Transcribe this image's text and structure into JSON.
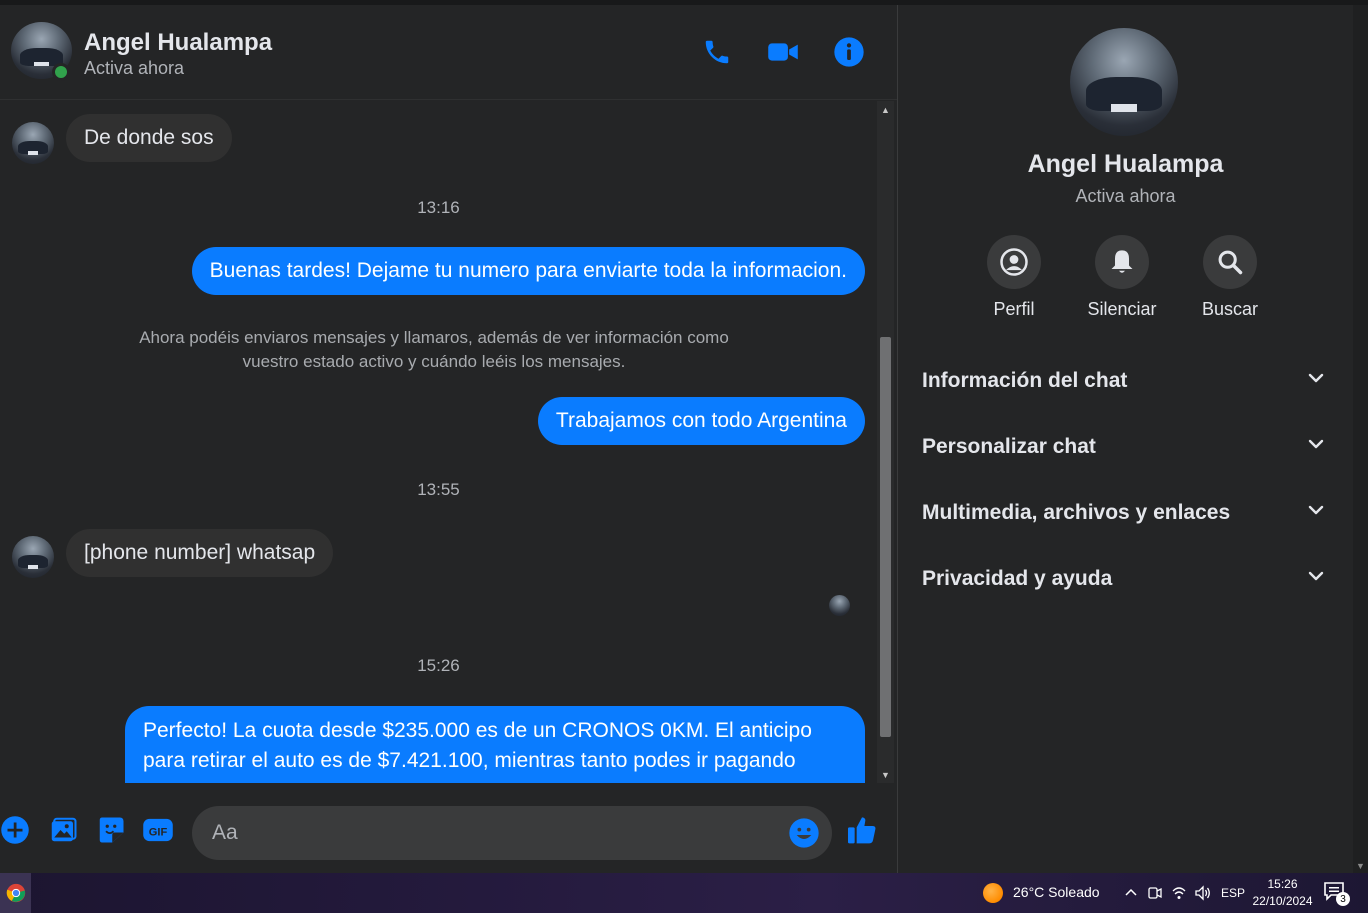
{
  "contact": {
    "name": "Angel Hualampa",
    "status": "Activa ahora"
  },
  "header": {
    "icons": [
      "phone-icon",
      "video-camera-icon",
      "info-icon"
    ]
  },
  "messages": [
    {
      "type": "incoming",
      "text": "De donde sos"
    },
    {
      "type": "timestamp",
      "text": "13:16"
    },
    {
      "type": "outgoing",
      "text": "Buenas tardes! Dejame tu numero para enviarte toda la informacion."
    },
    {
      "type": "system",
      "line1": "Ahora podéis enviaros mensajes y llamaros, además de ver información como",
      "line2": "vuestro estado activo y cuándo leéis los mensajes."
    },
    {
      "type": "outgoing",
      "text": "Trabajamos con todo Argentina"
    },
    {
      "type": "timestamp",
      "text": "13:55"
    },
    {
      "type": "incoming",
      "text": "[phone number] whatsap"
    },
    {
      "type": "timestamp",
      "text": "15:26"
    },
    {
      "type": "outgoing",
      "line1": "Perfecto! La cuota desde $235.000 es de un CRONOS 0KM. El anticipo",
      "line2": "para retirar el auto es de $7.421.100, mientras tanto podes ir pagando",
      "line3": "…"
    }
  ],
  "composer": {
    "placeholder": "Aa",
    "icons": [
      "plus-icon",
      "photo-icon",
      "sticker-icon",
      "gif-icon",
      "emoji-icon",
      "thumbs-up-icon"
    ]
  },
  "panel": {
    "actions": [
      {
        "label": "Perfil",
        "icon": "profile-icon"
      },
      {
        "label": "Silenciar",
        "icon": "bell-icon"
      },
      {
        "label": "Buscar",
        "icon": "search-icon"
      }
    ],
    "sections": [
      "Información del chat",
      "Personalizar chat",
      "Multimedia, archivos y enlaces",
      "Privacidad y ayuda"
    ]
  },
  "taskbar": {
    "weather": "26°C  Soleado",
    "language": "ESP",
    "time": "15:26",
    "date": "22/10/2024",
    "notification_count": "3"
  },
  "colors": {
    "accent": "#0a7cff",
    "background": "#242526",
    "bubble_in": "#303030",
    "online": "#31a24c"
  }
}
